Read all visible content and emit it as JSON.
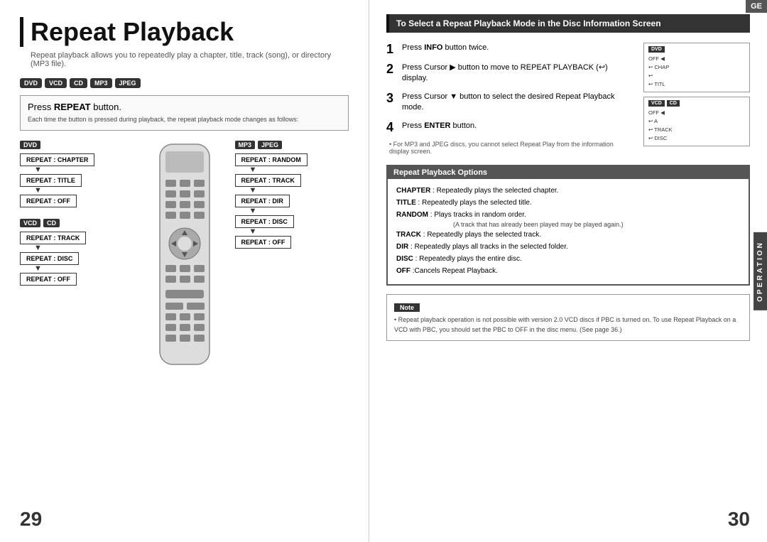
{
  "left": {
    "title": "Repeat Playback",
    "subtitle": "Repeat playback allows you to repeatedly play a chapter, title, track (song), or directory (MP3 file).",
    "badges": [
      "DVD",
      "VCD",
      "CD",
      "MP3",
      "JPEG"
    ],
    "press_repeat_title": "Press ",
    "press_repeat_bold": "REPEAT",
    "press_repeat_title2": " button.",
    "press_repeat_desc": "Each time the button is pressed during playback, the repeat playback mode changes as follows:",
    "dvd_flow": [
      "REPEAT : CHAPTER",
      "REPEAT : TITLE",
      "REPEAT : OFF"
    ],
    "mp3_jpeg_flow": [
      "REPEAT : RANDOM",
      "REPEAT : TRACK",
      "REPEAT : DIR",
      "REPEAT : DISC",
      "REPEAT : OFF"
    ],
    "vcd_cd_flow": [
      "REPEAT : TRACK",
      "REPEAT : DISC",
      "REPEAT : OFF"
    ],
    "page_number": "29"
  },
  "right": {
    "section_title": "To Select a Repeat Playback Mode in the Disc Information Screen",
    "steps": [
      {
        "num": "1",
        "text": "Press ",
        "bold": "INFO",
        "text2": " button twice."
      },
      {
        "num": "2",
        "text": "Press Cursor ▶ button to move to REPEAT PLAYBACK (↩) display."
      },
      {
        "num": "3",
        "text": "Press Cursor ▼ button to select the desired Repeat Playback mode."
      },
      {
        "num": "4",
        "text": "Press ",
        "bold": "ENTER",
        "text2": " button."
      }
    ],
    "step_note": "• For MP3 and JPEG discs, you cannot select Repeat Play from the information display screen.",
    "repeat_options_header": "Repeat Playback Options",
    "options": [
      {
        "bold": "CHAPTER",
        "text": " : Repeatedly plays the selected chapter."
      },
      {
        "bold": "TITLE",
        "text": " : Repeatedly plays the selected title."
      },
      {
        "bold": "RANDOM",
        "text": " : Plays tracks in random order."
      },
      {
        "sub": "(A track that has already been played may be played again.)"
      },
      {
        "bold": "TRACK",
        "text": " : Repeatedly plays the selected track."
      },
      {
        "bold": "DIR",
        "text": " : Repeatedly plays all tracks in the selected folder."
      },
      {
        "bold": "DISC",
        "text": " : Repeatedly plays the entire disc."
      },
      {
        "bold": "OFF",
        "text": " :Cancels Repeat Playback."
      }
    ],
    "note_label": "Note",
    "note_text": "• Repeat playback operation is not possible with version 2.0 VCD discs if PBC is turned on. To use Repeat Playback on a VCD with PBC, you should set the PBC to OFF in the disc menu. (See page 36.)",
    "page_number": "30",
    "ge_badge": "GE",
    "operation_label": "OPERATION"
  }
}
